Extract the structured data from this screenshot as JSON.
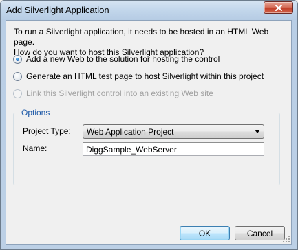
{
  "window": {
    "title": "Add Silverlight Application",
    "close_icon": "close-icon"
  },
  "intro": {
    "text": "To run a Silverlight application, it needs to be hosted in an HTML Web page.\nHow do you want to host this Silverlight application?"
  },
  "options": [
    {
      "label": "Add a new Web to the solution for hosting the control",
      "checked": true,
      "enabled": true
    },
    {
      "label": "Generate an HTML test page to host Silverlight within this project",
      "checked": false,
      "enabled": true
    },
    {
      "label": "Link this Silverlight control into an existing Web site",
      "checked": false,
      "enabled": false
    }
  ],
  "group": {
    "label": "Options",
    "project_type_label": "Project Type:",
    "project_type_value": "Web Application Project",
    "name_label": "Name:",
    "name_value": "DiggSample_WebServer"
  },
  "buttons": {
    "ok_label": "OK",
    "cancel_label": "Cancel"
  },
  "colors": {
    "group_label": "#1e5aa8",
    "default_button_border": "#3c7fb1",
    "close_button": "#c2402a"
  }
}
